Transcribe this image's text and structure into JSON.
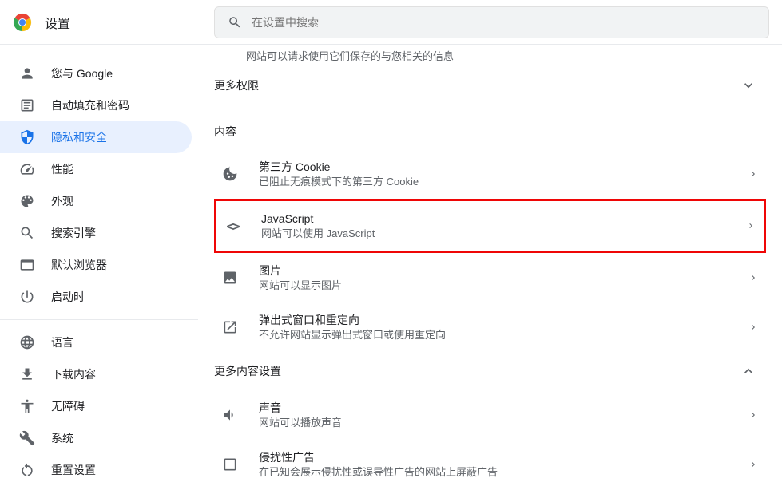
{
  "header": {
    "title": "设置",
    "search_placeholder": "在设置中搜索"
  },
  "sidebar": {
    "items": [
      {
        "label": "您与 Google",
        "icon": "person"
      },
      {
        "label": "自动填充和密码",
        "icon": "autofill"
      },
      {
        "label": "隐私和安全",
        "icon": "shield",
        "active": true
      },
      {
        "label": "性能",
        "icon": "performance"
      },
      {
        "label": "外观",
        "icon": "palette"
      },
      {
        "label": "搜索引擎",
        "icon": "search"
      },
      {
        "label": "默认浏览器",
        "icon": "browser"
      },
      {
        "label": "启动时",
        "icon": "power"
      }
    ],
    "items2": [
      {
        "label": "语言",
        "icon": "globe"
      },
      {
        "label": "下载内容",
        "icon": "download"
      },
      {
        "label": "无障碍",
        "icon": "accessibility"
      },
      {
        "label": "系统",
        "icon": "wrench"
      },
      {
        "label": "重置设置",
        "icon": "reset"
      }
    ]
  },
  "content": {
    "truncated_text": "网站可以请求使用它们保存的与您相关的信息",
    "more_permissions": "更多权限",
    "content_label": "内容",
    "rows": [
      {
        "title": "第三方 Cookie",
        "desc": "已阻止无痕模式下的第三方 Cookie",
        "icon": "cookie"
      },
      {
        "title": "JavaScript",
        "desc": "网站可以使用 JavaScript",
        "icon": "code",
        "highlight": true
      },
      {
        "title": "图片",
        "desc": "网站可以显示图片",
        "icon": "image"
      },
      {
        "title": "弹出式窗口和重定向",
        "desc": "不允许网站显示弹出式窗口或使用重定向",
        "icon": "popup"
      }
    ],
    "more_content": "更多内容设置",
    "rows2": [
      {
        "title": "声音",
        "desc": "网站可以播放声音",
        "icon": "sound"
      },
      {
        "title": "侵扰性广告",
        "desc": "在已知会展示侵扰性或误导性广告的网站上屏蔽广告",
        "icon": "ads"
      }
    ]
  }
}
